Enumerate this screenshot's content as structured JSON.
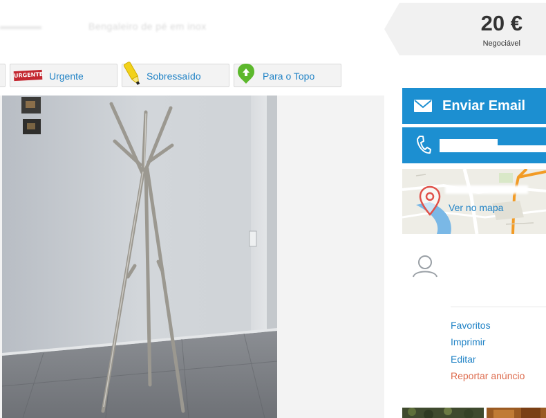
{
  "listing": {
    "title": "Bengaleiro de pé em inox"
  },
  "price": {
    "value": "20 €",
    "note": "Negociável"
  },
  "promotions": [
    {
      "label": "Urgente",
      "badge": "URGENTE"
    },
    {
      "label": "Sobressaído"
    },
    {
      "label": "Para o Topo"
    }
  ],
  "contact": {
    "email_label": "Enviar Email",
    "map_link": "Ver no mapa"
  },
  "actions": {
    "favorites": "Favoritos",
    "print": "Imprimir",
    "edit": "Editar",
    "report": "Reportar anúncio"
  },
  "colors": {
    "accent": "#1c8fd1",
    "link": "#2183c6",
    "report": "#dd6b4d",
    "urgent": "#c32730"
  },
  "icons": [
    "urgente-badge-icon",
    "highlighter-icon",
    "arrow-up-icon",
    "envelope-icon",
    "phone-icon",
    "map-pin-icon",
    "user-icon"
  ]
}
